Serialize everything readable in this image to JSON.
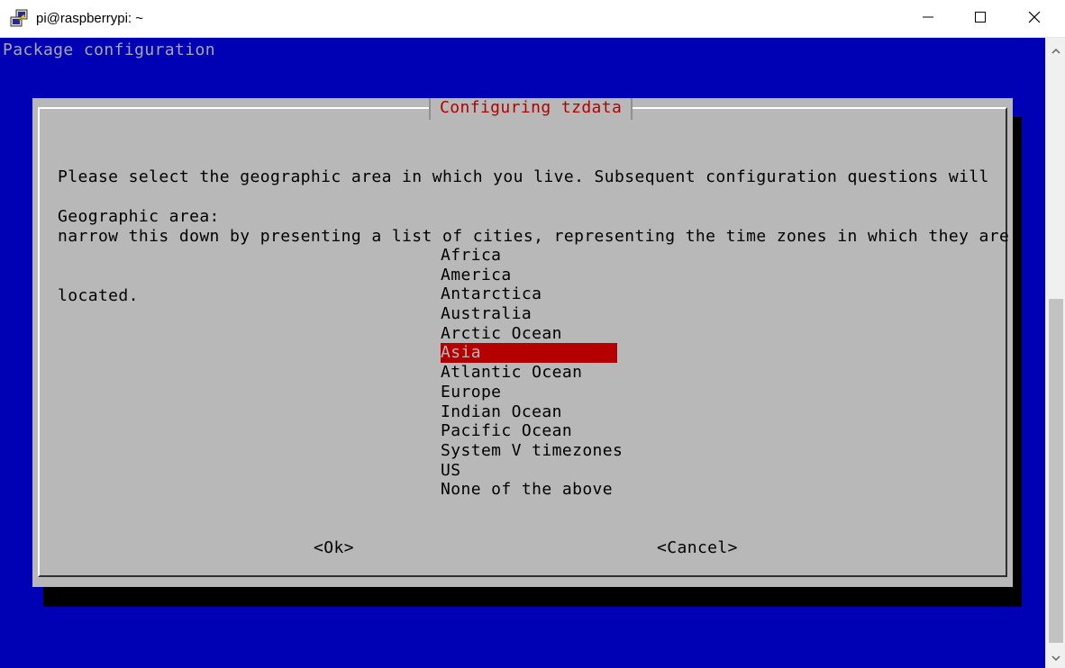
{
  "window": {
    "title": "pi@raspberrypi: ~",
    "icon": "putty-icon",
    "controls": [
      "minimize-icon",
      "maximize-icon",
      "close-icon"
    ]
  },
  "terminal": {
    "header": "Package configuration",
    "colors": {
      "background": "#0000b4",
      "dialog": "#b8b8b8",
      "highlight": "#b40000",
      "shadow": "#000000"
    }
  },
  "dialog": {
    "title": "Configuring tzdata",
    "message_lines": [
      "Please select the geographic area in which you live. Subsequent configuration questions will",
      "narrow this down by presenting a list of cities, representing the time zones in which they are",
      "located."
    ],
    "prompt": "Geographic area:",
    "areas": [
      "Africa",
      "America",
      "Antarctica",
      "Australia",
      "Arctic Ocean",
      "Asia",
      "Atlantic Ocean",
      "Europe",
      "Indian Ocean",
      "Pacific Ocean",
      "System V timezones",
      "US",
      "None of the above"
    ],
    "selected_area": "Asia",
    "ok_label": "<Ok>",
    "cancel_label": "<Cancel>"
  }
}
